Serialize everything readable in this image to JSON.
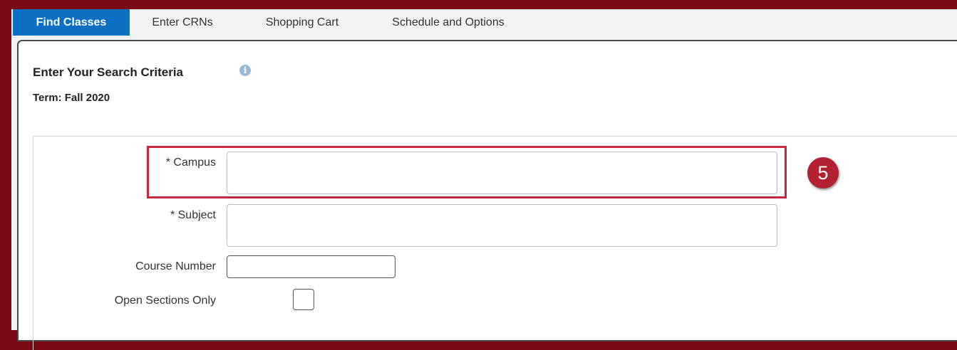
{
  "tabs": [
    {
      "label": "Find Classes",
      "active": true
    },
    {
      "label": "Enter CRNs",
      "active": false
    },
    {
      "label": "Shopping Cart",
      "active": false
    },
    {
      "label": "Schedule and Options",
      "active": false
    }
  ],
  "panel": {
    "title": "Enter Your Search Criteria",
    "info_icon": "info-icon",
    "term": "Term: Fall 2020"
  },
  "form": {
    "campus_label": "* Campus",
    "campus_value": "",
    "subject_label": "* Subject",
    "subject_value": "",
    "course_number_label": "Course Number",
    "course_number_value": "",
    "open_sections_label": "Open Sections Only",
    "open_sections_checked": false
  },
  "annotation": {
    "step_number": "5"
  },
  "colors": {
    "page_background": "#7a0a14",
    "active_tab": "#0b6fc4",
    "highlight": "#c3283e",
    "badge": "#b3202f"
  }
}
